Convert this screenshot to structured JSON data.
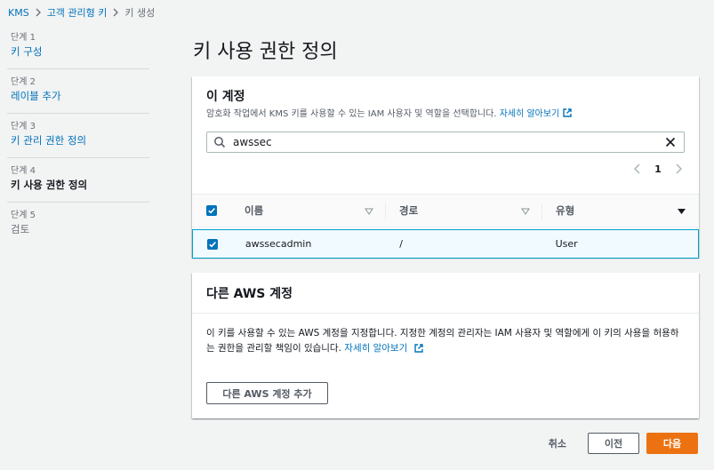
{
  "breadcrumb": {
    "items": [
      "KMS",
      "고객 관리형 키",
      "키 생성"
    ]
  },
  "steps": [
    {
      "num": "단계 1",
      "title": "키 구성",
      "state": "link"
    },
    {
      "num": "단계 2",
      "title": "레이블 추가",
      "state": "link"
    },
    {
      "num": "단계 3",
      "title": "키 관리 권한 정의",
      "state": "link"
    },
    {
      "num": "단계 4",
      "title": "키 사용 권한 정의",
      "state": "active"
    },
    {
      "num": "단계 5",
      "title": "검토",
      "state": "disabled"
    }
  ],
  "page": {
    "title": "키 사용 권한 정의"
  },
  "this_account": {
    "title": "이 계정",
    "description": "암호화 작업에서 KMS 키를 사용할 수 있는 IAM 사용자 및 역할을 선택합니다.",
    "learn_more": "자세히 알아보기",
    "search": {
      "value": "awssec",
      "placeholder": ""
    },
    "pagination": {
      "current_page": "1"
    },
    "table": {
      "columns": [
        "이름",
        "경로",
        "유형"
      ],
      "rows": [
        {
          "name": "awssecadmin",
          "path": "/",
          "type": "User",
          "checked": true
        }
      ]
    }
  },
  "other_accounts": {
    "title": "다른 AWS 계정",
    "description": "이 키를 사용할 수 있는 AWS 계정을 지정합니다. 지정한 계정의 관리자는 IAM 사용자 및 역할에게 이 키의 사용을 허용하는 권한을 관리할 책임이 있습니다.",
    "learn_more": "자세히 알아보기",
    "add_button": "다른 AWS 계정 추가"
  },
  "footer": {
    "cancel": "취소",
    "previous": "이전",
    "next": "다음"
  },
  "colors": {
    "link": "#0073bb",
    "primary_button": "#ec7211",
    "selected_row_border": "#00a1c9",
    "background": "#f2f3f3"
  },
  "icons": [
    "chevron-right-icon",
    "search-icon",
    "close-icon",
    "chevron-left-icon",
    "sort-caret-icon",
    "sort-caret-solid-icon",
    "checkmark-icon",
    "external-link-icon"
  ]
}
